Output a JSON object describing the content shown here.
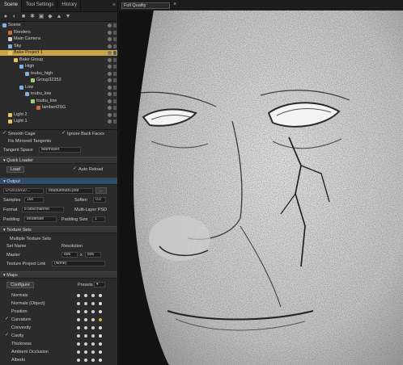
{
  "tabs": [
    "Scene",
    "Tool Settings",
    "History"
  ],
  "toolbar": {
    "icons": [
      "pointer-icon",
      "sphere-icon",
      "cube-icon",
      "light-icon",
      "camera-icon",
      "bake-icon",
      "import-icon",
      "export-icon"
    ]
  },
  "scene_tree": [
    {
      "label": "Scene",
      "indent": 0,
      "icon_color": "#7fb2e5"
    },
    {
      "label": "Renders",
      "indent": 1,
      "icon_color": "#d06a3a"
    },
    {
      "label": "Main Camera",
      "indent": 1,
      "icon_color": "#d0d0d0"
    },
    {
      "label": "Sky",
      "indent": 1,
      "icon_color": "#7fb2e5"
    },
    {
      "label": "Bake Project 1",
      "indent": 1,
      "icon_color": "#e9c45a",
      "selected": true
    },
    {
      "label": "Bake Group",
      "indent": 2,
      "icon_color": "#e9c45a"
    },
    {
      "label": "High",
      "indent": 3,
      "icon_color": "#7fb2e5"
    },
    {
      "label": "toubu_high",
      "indent": 4,
      "icon_color": "#7fb2e5"
    },
    {
      "label": "Group32353",
      "indent": 5,
      "icon_color": "#9fd06a"
    },
    {
      "label": "Low",
      "indent": 3,
      "icon_color": "#7fb2e5"
    },
    {
      "label": "toubu_low",
      "indent": 4,
      "icon_color": "#7fb2e5"
    },
    {
      "label": "toubu_low",
      "indent": 5,
      "icon_color": "#9fd06a"
    },
    {
      "label": "lambert2SG",
      "indent": 6,
      "icon_color": "#d06a3a"
    },
    {
      "label": "Light 2",
      "indent": 1,
      "icon_color": "#e9c45a"
    },
    {
      "label": "Light 1",
      "indent": 1,
      "icon_color": "#e9c45a"
    }
  ],
  "options": {
    "smooth_cage": "Smooth Cage",
    "ignore_back_faces": "Ignore Back Faces",
    "fix_mirrored_tangents": "Fix Mirrored Tangents",
    "tangent_space_label": "Tangent Space",
    "tangent_space_value": "Marmoset"
  },
  "quick_loader": {
    "title": "Quick Loader",
    "load": "Load",
    "auto_reload": "Auto Reload"
  },
  "output": {
    "title": "Output",
    "path": "D:/2015/02/...",
    "file": "/toubu/toubu.psd",
    "browse": "...",
    "samples_label": "Samples",
    "samples_value": "16x",
    "soften_label": "Soften",
    "soften_value": "0.0",
    "format_label": "Format",
    "format_value": "8 bits/channel",
    "multi_layer_psd": "Multi-Layer PSD",
    "padding_label": "Padding",
    "padding_value": "Moderate",
    "padding_size_label": "Padding Size",
    "padding_size_value": "1"
  },
  "texture_sets": {
    "title": "Texture Sets",
    "multiple": "Multiple Texture Sets",
    "set_name_col": "Set Name",
    "resolution_col": "Resolution",
    "master": "Master",
    "res_w": "896",
    "res_x": "x",
    "res_h": "896",
    "project_link_label": "Texture Project Link",
    "project_link_value": "(None)"
  },
  "maps": {
    "title": "Maps",
    "configure": "Configure",
    "presets": "Presets",
    "items": [
      {
        "label": "Normals",
        "checked": false
      },
      {
        "label": "Normals (Object)",
        "checked": false
      },
      {
        "label": "Position",
        "checked": false
      },
      {
        "label": "Curvature",
        "checked": true
      },
      {
        "label": "Convexity",
        "checked": false
      },
      {
        "label": "Cavity",
        "checked": true
      },
      {
        "label": "Thickness",
        "checked": false
      },
      {
        "label": "Ambient Occlusion",
        "checked": false
      },
      {
        "label": "Albedo",
        "checked": false
      }
    ]
  },
  "viewport": {
    "quality": "Full Quality"
  },
  "colors": {
    "accent": "#c8a44a",
    "panel": "#2b2b2b",
    "section_blue": "#2d4d6b"
  }
}
